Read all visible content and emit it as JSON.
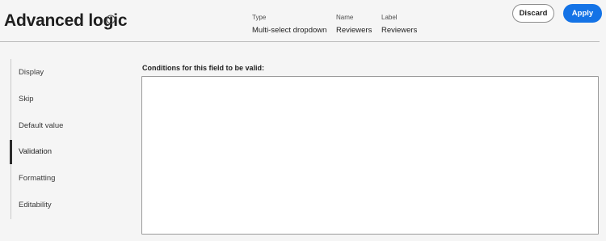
{
  "header": {
    "title": "Advanced logic",
    "meta": [
      {
        "label": "Type",
        "value": "Multi-select dropdown"
      },
      {
        "label": "Name",
        "value": "Reviewers"
      },
      {
        "label": "Label",
        "value": "Reviewers"
      }
    ],
    "discard_label": "Discard",
    "apply_label": "Apply"
  },
  "sidebar": {
    "items": [
      {
        "label": "Display"
      },
      {
        "label": "Skip"
      },
      {
        "label": "Default value"
      },
      {
        "label": "Validation"
      },
      {
        "label": "Formatting"
      },
      {
        "label": "Editability"
      }
    ],
    "active": "Validation"
  },
  "main": {
    "conditions_label": "Conditions for this field to be valid:",
    "conditions_value": ""
  },
  "colors": {
    "accent": "#1473e6",
    "background": "#f5f5f5",
    "active_indicator": "#2c2c2c"
  }
}
